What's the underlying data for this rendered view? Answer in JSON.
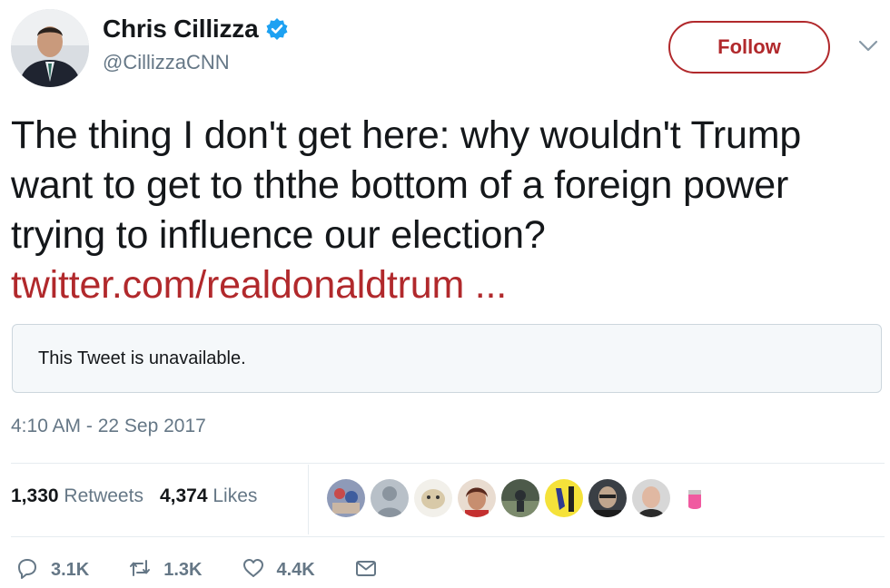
{
  "author": {
    "name": "Chris Cillizza",
    "handle": "@CillizzaCNN",
    "verified": true
  },
  "follow_label": "Follow",
  "tweet": {
    "text": "The thing I don't get here: why wouldn't Trump want to get to ththe bottom of a foreign power trying to influence our election? ",
    "link": "twitter.com/realdonaldtrum ...",
    "quoted_status": "This Tweet is unavailable.",
    "timestamp": "4:10 AM - 22 Sep 2017"
  },
  "stats": {
    "retweets_count": "1,330",
    "retweets_label": "Retweets",
    "likes_count": "4,374",
    "likes_label": "Likes"
  },
  "actions": {
    "reply_count": "3.1K",
    "retweet_count": "1.3K",
    "like_count": "4.4K"
  },
  "colors": {
    "accent": "#b1292c",
    "verified": "#1da1f2",
    "muted": "#657786",
    "border": "#e6ecf0"
  },
  "icons": [
    "verified-badge-icon",
    "chevron-down-icon",
    "reply-icon",
    "retweet-icon",
    "like-icon",
    "direct-message-icon"
  ]
}
